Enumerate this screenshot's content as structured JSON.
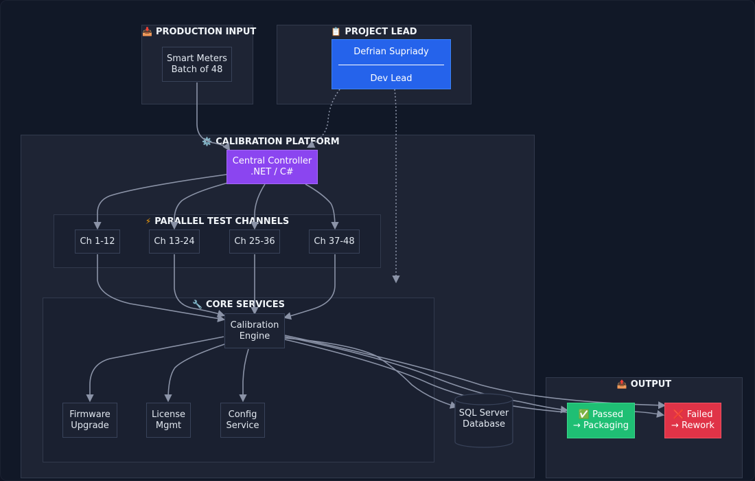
{
  "clusters": {
    "production_input": {
      "icon": "📥",
      "title": "PRODUCTION INPUT"
    },
    "project_lead": {
      "icon": "📋",
      "title": "PROJECT LEAD"
    },
    "calibration_platform": {
      "icon": "⚙️",
      "title": "CALIBRATION PLATFORM"
    },
    "parallel_channels": {
      "icon": "⚡",
      "title": "PARALLEL TEST CHANNELS"
    },
    "core_services": {
      "icon": "🔧",
      "title": "CORE SERVICES"
    },
    "output": {
      "icon": "📤",
      "title": "OUTPUT"
    }
  },
  "nodes": {
    "smart_meters": {
      "line1": "Smart Meters",
      "line2": "Batch of 48"
    },
    "project_lead": {
      "name": "Defrian Supriady",
      "role": "Dev Lead"
    },
    "central_controller": {
      "line1": "Central Controller",
      "line2": ".NET / C#"
    },
    "channels": [
      "Ch 1-12",
      "Ch 13-24",
      "Ch 25-36",
      "Ch 37-48"
    ],
    "calibration_engine": {
      "line1": "Calibration",
      "line2": "Engine"
    },
    "firmware_upgrade": {
      "line1": "Firmware",
      "line2": "Upgrade"
    },
    "license_mgmt": {
      "line1": "License",
      "line2": "Mgmt"
    },
    "config_service": {
      "line1": "Config",
      "line2": "Service"
    },
    "sql_server": {
      "line1": "SQL Server",
      "line2": "Database"
    },
    "passed": {
      "line1": "✅ Passed",
      "line2": "→ Packaging"
    },
    "failed": {
      "line1": "❌ Failed",
      "line2": "→ Rework"
    }
  },
  "colors": {
    "background": "#111827",
    "cluster": "#1e2434",
    "edge": "#8b93a7",
    "lead": "#2563eb",
    "central": "#8b45f0",
    "passed": "#1fbf74",
    "failed": "#e03347"
  }
}
